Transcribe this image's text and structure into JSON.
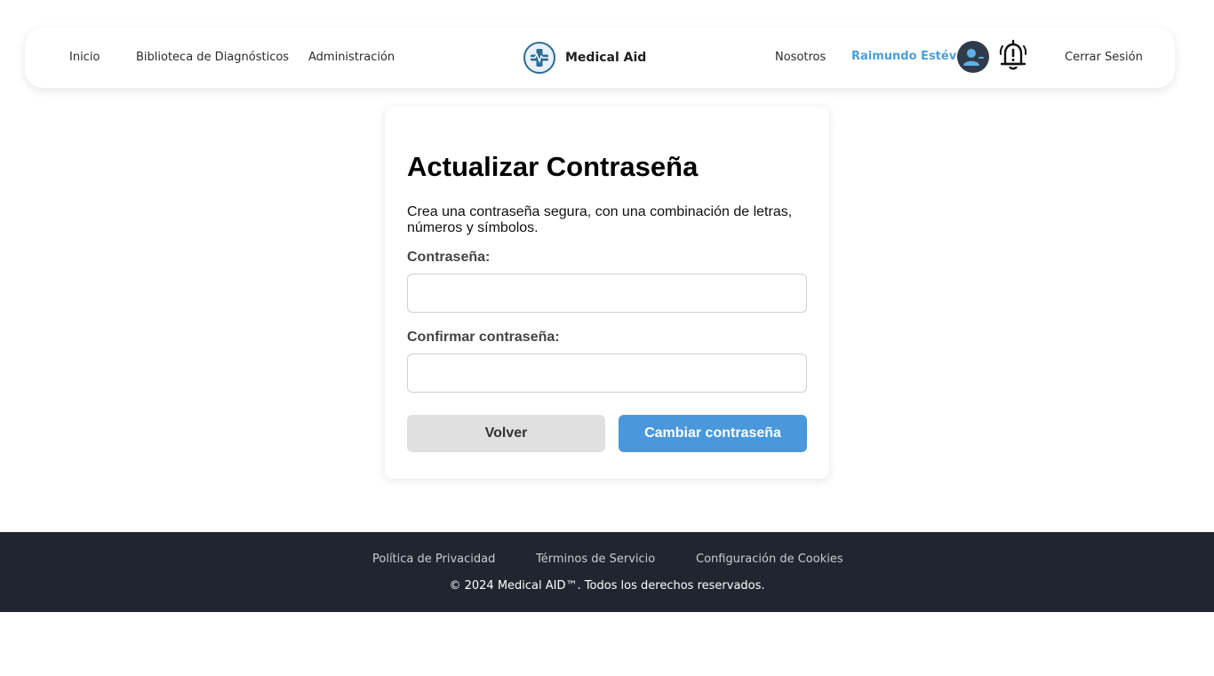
{
  "nav": {
    "links_left": [
      "Inicio",
      "Biblioteca de Diagnósticos",
      "Administración"
    ],
    "brand_name": "Medical Aid",
    "brand_icon": "medical-cross-logo",
    "about_link": "Nosotros",
    "user_name": "Raimundo Estévez",
    "avatar_icon": "user-avatar-icon",
    "notification_icon": "bell-alert-icon",
    "logout_link": "Cerrar Sesión"
  },
  "form": {
    "title": "Actualizar Contraseña",
    "description": "Crea una contraseña segura, con una combinación de letras, números y símbolos.",
    "password_label": "Contraseña:",
    "password_value": "",
    "confirm_label": "Confirmar contraseña:",
    "confirm_value": "",
    "back_button": "Volver",
    "submit_button": "Cambiar contraseña"
  },
  "footer": {
    "links": [
      "Política de Privacidad",
      "Términos de Servicio",
      "Configuración de Cookies"
    ],
    "copyright": "© 2024 Medical AID™. Todos los derechos reservados."
  },
  "colors": {
    "accent": "#4a97db",
    "user_name": "#4a9fdc",
    "footer_bg": "#1f2630",
    "back_button_bg": "#e0e0e0"
  }
}
